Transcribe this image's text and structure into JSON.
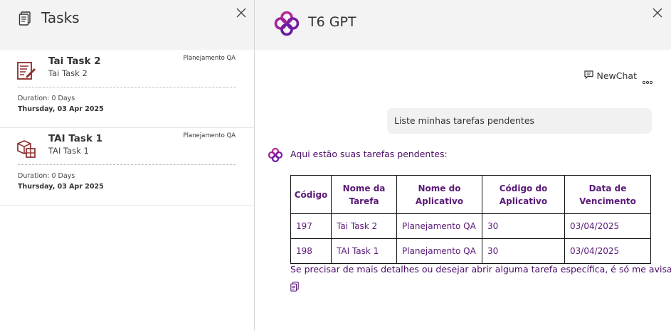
{
  "tasks_panel": {
    "title": "Tasks",
    "tasks": [
      {
        "icon": "form-edit-icon",
        "title": "Tai Task 2",
        "subtitle": "Tai Task 2",
        "app": "Planejamento QA",
        "duration": "Duration: 0 Days",
        "date": "Thursday, 03 Apr 2025"
      },
      {
        "icon": "boxes-icon",
        "title": "TAI Task 1",
        "subtitle": "TAI Task 1",
        "app": "Planejamento QA",
        "duration": "Duration: 0 Days",
        "date": "Thursday, 03 Apr 2025"
      }
    ]
  },
  "chat_panel": {
    "title": "T6 GPT",
    "newchat_label": "NewChat",
    "user_message": "Liste minhas tarefas pendentes",
    "bot_intro": "Aqui estão suas tarefas pendentes:",
    "table": {
      "headers": [
        "Código",
        "Nome da Tarefa",
        "Nome do Aplicativo",
        "Código do Aplicativo",
        "Data de Vencimento"
      ],
      "rows": [
        [
          "197",
          "Tai Task 2",
          "Planejamento QA",
          "30",
          "03/04/2025"
        ],
        [
          "198",
          "TAI Task 1",
          "Planejamento QA",
          "30",
          "03/04/2025"
        ]
      ]
    },
    "bot_footer": "Se precisar de mais detalhes ou desejar abrir alguma tarefa específica, é só me avisar!"
  },
  "colors": {
    "accent": "#5a1a78",
    "brand_magenta": "#b3299a",
    "task_icon": "#8b2a2a",
    "header_bg": "#f3f3f3"
  }
}
